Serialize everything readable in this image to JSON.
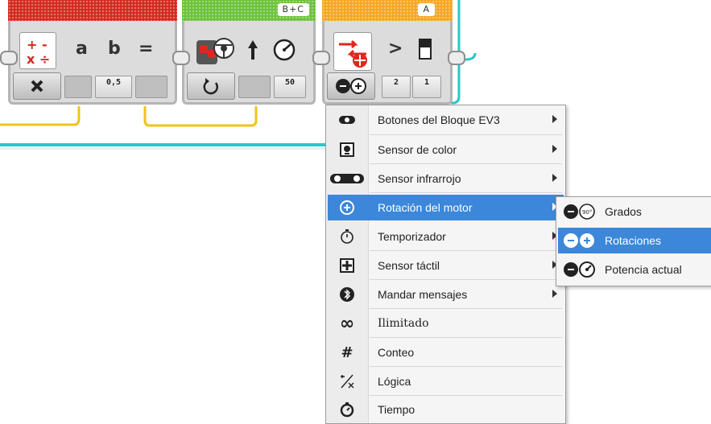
{
  "blocks": {
    "math": {
      "operator_a": "a",
      "operator_b": "b",
      "equals": "=",
      "value_slot": "0,5",
      "color": "#d22a1e"
    },
    "motor": {
      "port_badge": "B+C",
      "power_value": "50",
      "color": "#6cc23a"
    },
    "compare": {
      "port_badge": "A",
      "greater_symbol": ">",
      "slot_1": "2",
      "slot_2": "1",
      "color": "#f5a623"
    }
  },
  "menu": {
    "items": [
      {
        "label": "Botones del Bloque EV3",
        "icon": "brick-buttons-icon",
        "submenu": true
      },
      {
        "label": "Sensor de color",
        "icon": "color-sensor-icon",
        "submenu": true
      },
      {
        "label": "Sensor infrarrojo",
        "icon": "infrared-sensor-icon",
        "submenu": true
      },
      {
        "label": "Rotación del motor",
        "icon": "motor-rotation-icon",
        "submenu": true,
        "active": true
      },
      {
        "label": "Temporizador",
        "icon": "timer-icon",
        "submenu": true
      },
      {
        "label": "Sensor táctil",
        "icon": "touch-sensor-icon",
        "submenu": true
      },
      {
        "label": "Mandar mensajes",
        "icon": "bluetooth-icon",
        "submenu": true
      },
      {
        "label": "Ilimitado",
        "icon": "infinity-icon",
        "submenu": false
      },
      {
        "label": "Conteo",
        "icon": "hash-icon",
        "submenu": false
      },
      {
        "label": "Lógica",
        "icon": "logic-icon",
        "submenu": false
      },
      {
        "label": "Tiempo",
        "icon": "stopwatch-icon",
        "submenu": false
      }
    ],
    "submenu": {
      "items": [
        {
          "label": "Grados",
          "icon": "degrees-icon"
        },
        {
          "label": "Rotaciones",
          "icon": "rotations-icon",
          "active": true
        },
        {
          "label": "Potencia actual",
          "icon": "current-power-icon"
        }
      ]
    }
  },
  "colors": {
    "accent": "#3c87d9",
    "wire_yellow": "#f0c419",
    "wire_cyan": "#28c7c7"
  }
}
